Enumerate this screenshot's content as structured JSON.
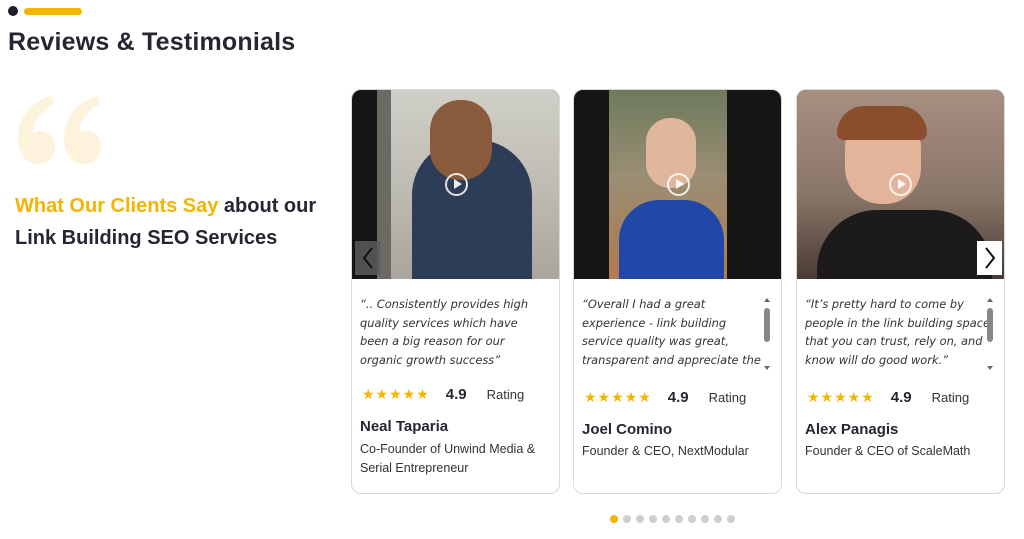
{
  "section": {
    "title": "Reviews & Testimonials"
  },
  "intro": {
    "highlight": "What Our Clients Say",
    "rest": " about our Link Building SEO Services"
  },
  "testimonials": [
    {
      "quote": "“.. Consistently provides high quality services which have been a big reason for our organic growth success”",
      "stars": "★★★★★",
      "score": "4.9",
      "rating_label": "Rating",
      "name": "Neal Taparia",
      "role": "Co-Founder of Unwind Media & Serial Entrepreneur"
    },
    {
      "quote": "“Overall I had a great experience - link building service quality was great, transparent and appreciate the prompt communication.”",
      "stars": "★★★★★",
      "score": "4.9",
      "rating_label": "Rating",
      "name": "Joel Comino",
      "role": "Founder & CEO, NextModular"
    },
    {
      "quote": "“It’s pretty hard to come by people in the link building space that you can trust, rely on, and know will do good work.”",
      "stars": "★★★★★",
      "score": "4.9",
      "rating_label": "Rating",
      "name": "Alex Panagis",
      "role": "Founder & CEO of ScaleMath"
    }
  ],
  "carousel": {
    "page_count": 10,
    "active_page": 1
  },
  "icons": {
    "quote": "quote-icon",
    "play": "play-icon",
    "prev": "chevron-left-icon",
    "next": "chevron-right-icon",
    "star": "star-icon"
  },
  "colors": {
    "accent": "#f5b400",
    "heading": "#262632",
    "quote_mark": "#fdf3dc"
  }
}
